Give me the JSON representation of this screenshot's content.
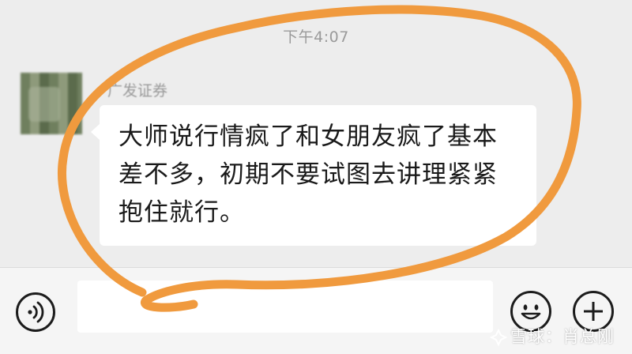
{
  "chat": {
    "timestamp": "下午4:07",
    "sender_name": "广发证券",
    "message": "大师说行情疯了和女朋友疯了基本\n差不多，初期不要试图去讲理紧紧\n抱住就行。"
  },
  "input_bar": {
    "voice_icon": "voice-icon",
    "emoji_icon": "smiley-icon",
    "plus_icon": "plus-icon"
  },
  "watermark": {
    "text": "雪球：肖总刚"
  },
  "colors": {
    "annotation_stroke": "#f09a3e",
    "bubble": "#ffffff",
    "chat_background": "#ededed"
  }
}
